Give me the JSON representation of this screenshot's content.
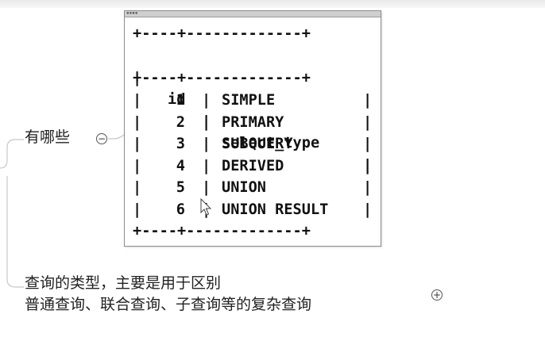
{
  "mindmap": {
    "node_label": "有哪些",
    "collapse_symbol": "−",
    "expand_symbol": "+",
    "description_line1": "查询的类型，主要是用于区别",
    "description_line2": "普通查询、联合查询、子查询等的复杂查询"
  },
  "console": {
    "title_grip": "▪▪▪▪",
    "border_line": "+----+-------------+",
    "header_id": "id",
    "header_type": "select_type",
    "rows": [
      {
        "id": "1",
        "select_type": "SIMPLE"
      },
      {
        "id": "2",
        "select_type": "PRIMARY"
      },
      {
        "id": "3",
        "select_type": "SUBQUERY"
      },
      {
        "id": "4",
        "select_type": "DERIVED"
      },
      {
        "id": "5",
        "select_type": "UNION"
      },
      {
        "id": "6",
        "select_type": "UNION RESULT"
      }
    ]
  }
}
